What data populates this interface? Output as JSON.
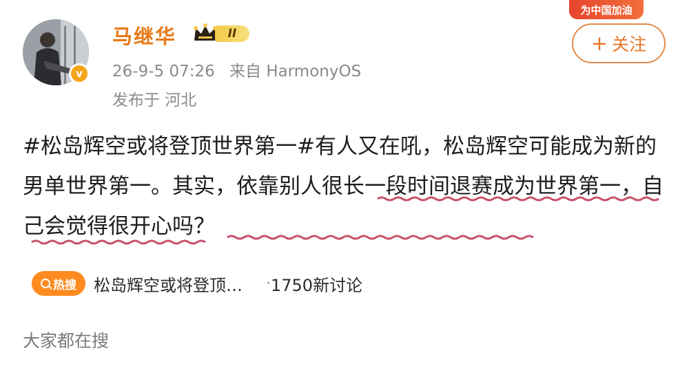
{
  "banner": {
    "text": "为中国加油"
  },
  "user": {
    "name": "马继华",
    "level": "II",
    "verified_badge": "v",
    "avatar_icon": "user-avatar-photo"
  },
  "post_meta": {
    "datetime": "26-9-5 07:26",
    "source": "来自 HarmonyOS",
    "location": "发布于 河北"
  },
  "follow_button": {
    "label": "关注",
    "icon": "plus-icon"
  },
  "post": {
    "hashtag": "#松岛辉空或将登顶世界第一#",
    "text_1": "有人又在吼，松岛辉空可能成为新的男单世界第一。其实，",
    "text_2": "依靠别人很长一段时间退赛成为世界第一，自己会觉得很开心吗？",
    "text_2_underline_color": "#c9516c"
  },
  "hot_search": {
    "badge": "热搜",
    "topic": "松岛辉空或将登顶…",
    "dot": "·",
    "count": "1750新讨论",
    "badge_color": "#ff8a1f"
  },
  "section": {
    "title": "大家都在搜"
  },
  "colors": {
    "username": "#e97919",
    "meta": "#8a8a8a",
    "follow": "#e5772a"
  }
}
